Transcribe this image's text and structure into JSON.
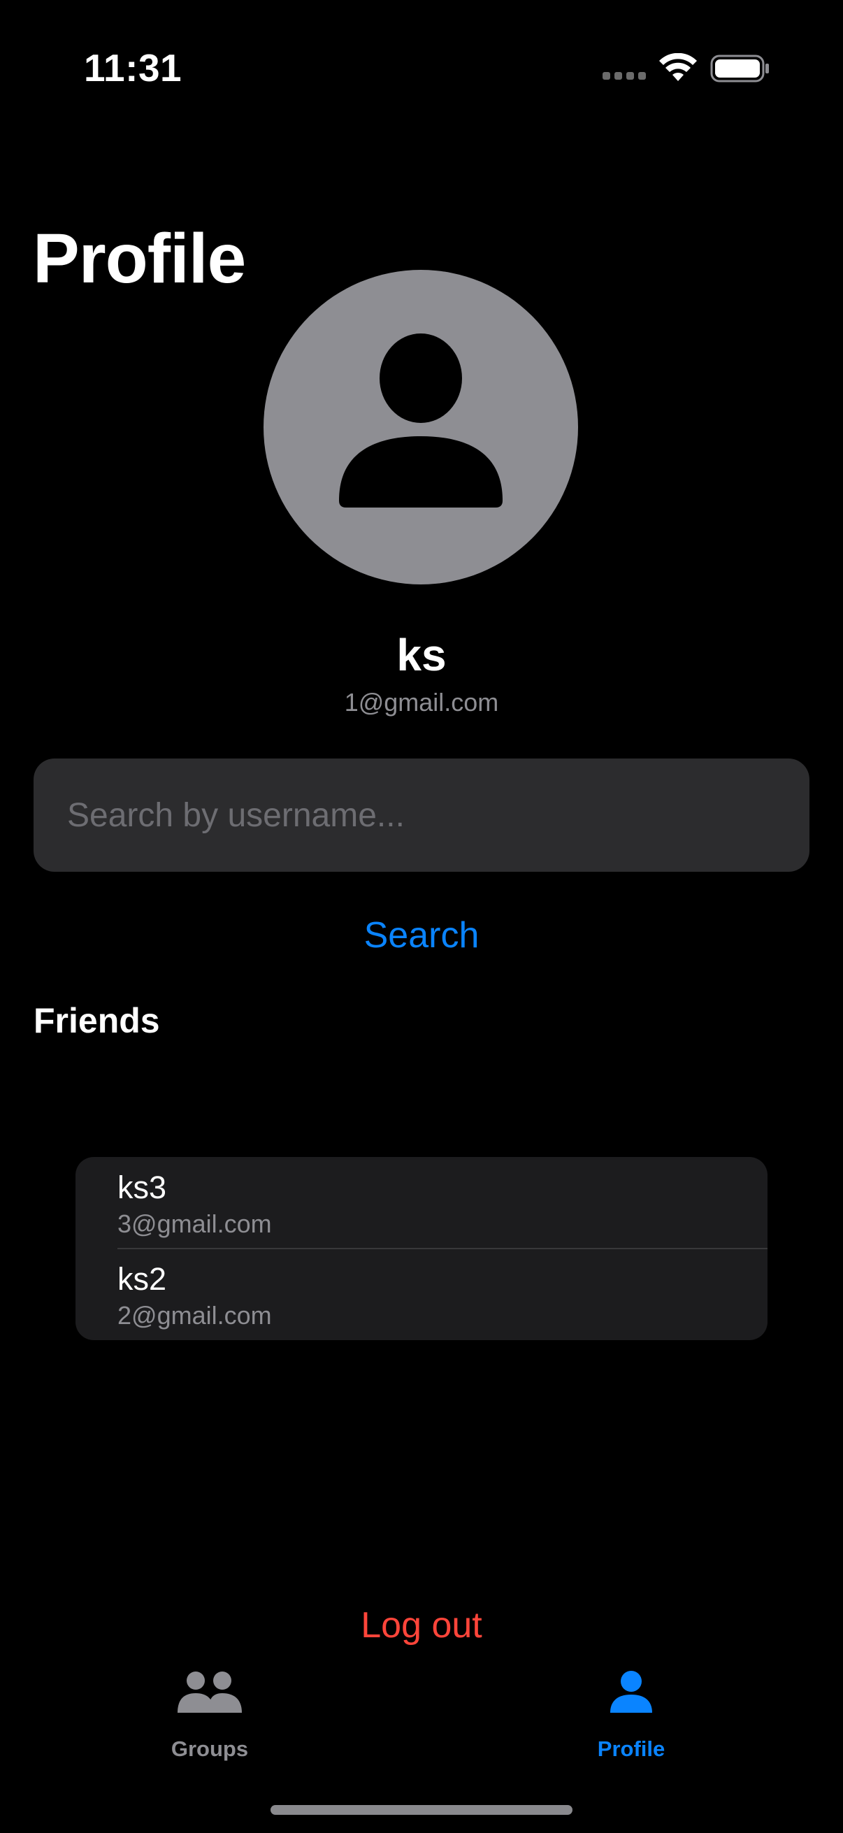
{
  "status_bar": {
    "time": "11:31"
  },
  "page": {
    "title": "Profile"
  },
  "profile": {
    "name": "ks",
    "email": "1@gmail.com",
    "avatar_icon": "person-circle-icon"
  },
  "search": {
    "placeholder": "Search by username...",
    "value": "",
    "button_label": "Search"
  },
  "friends": {
    "heading": "Friends",
    "items": [
      {
        "name": "ks3",
        "email": "3@gmail.com"
      },
      {
        "name": "ks2",
        "email": "2@gmail.com"
      }
    ]
  },
  "actions": {
    "logout_label": "Log out"
  },
  "tab_bar": {
    "tabs": [
      {
        "label": "Groups",
        "icon": "people-icon",
        "selected": false
      },
      {
        "label": "Profile",
        "icon": "person-icon",
        "selected": true
      }
    ]
  },
  "colors": {
    "accent": "#0a84ff",
    "destructive": "#ff453a",
    "inactive_tab": "#8e8e93",
    "background": "#000000"
  }
}
